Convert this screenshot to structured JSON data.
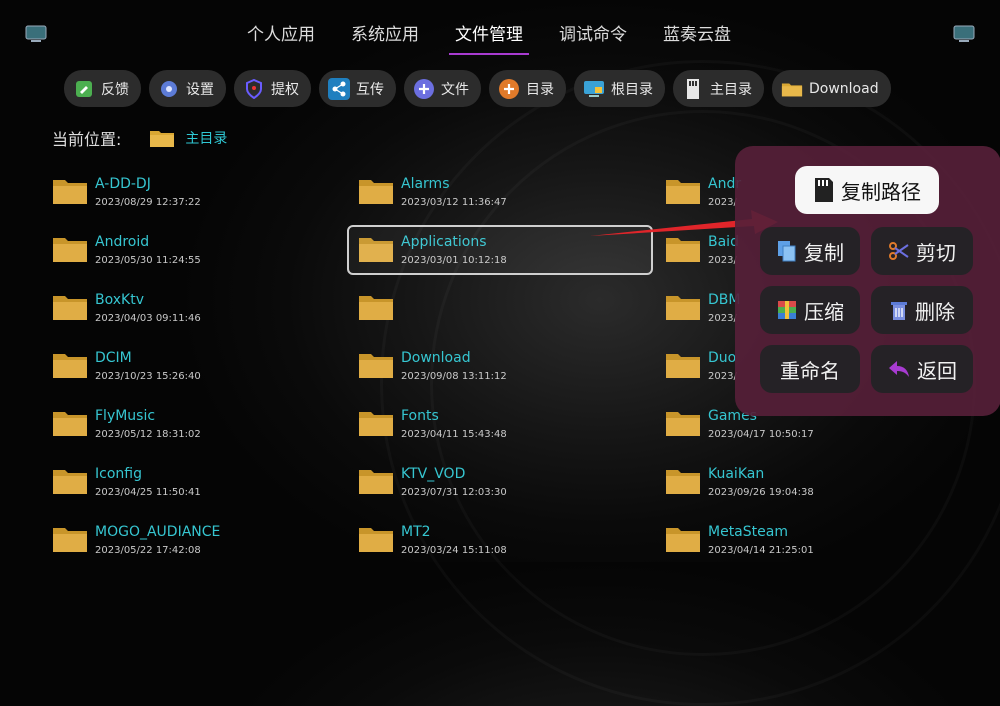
{
  "tabs": [
    {
      "label": "个人应用"
    },
    {
      "label": "系统应用"
    },
    {
      "label": "文件管理",
      "active": true
    },
    {
      "label": "调试命令"
    },
    {
      "label": "蓝奏云盘"
    }
  ],
  "toolbar": [
    {
      "label": "反馈",
      "icon": "feedback-icon"
    },
    {
      "label": "设置",
      "icon": "gear-icon"
    },
    {
      "label": "提权",
      "icon": "shield-icon"
    },
    {
      "label": "互传",
      "icon": "share-icon"
    },
    {
      "label": "文件",
      "icon": "add-file-icon"
    },
    {
      "label": "目录",
      "icon": "add-folder-icon"
    },
    {
      "label": "根目录",
      "icon": "root-dir-icon"
    },
    {
      "label": "主目录",
      "icon": "home-dir-icon"
    },
    {
      "label": "Download",
      "icon": "folder-icon"
    }
  ],
  "location": {
    "label": "当前位置:",
    "path": "主目录"
  },
  "files": [
    {
      "name": "A-DD-DJ",
      "date": "2023/08/29 12:37:22"
    },
    {
      "name": "Alarms",
      "date": "2023/03/12 11:36:47"
    },
    {
      "name": "Andr",
      "date": "2023/"
    },
    {
      "name": "Android",
      "date": "2023/05/30 11:24:55"
    },
    {
      "name": "Applications",
      "date": "2023/03/01 10:12:18"
    },
    {
      "name": "Baid",
      "date": "2023/"
    },
    {
      "name": "BoxKtv",
      "date": "2023/04/03 09:11:46"
    },
    {
      "name": "",
      "date": ""
    },
    {
      "name": "DBM",
      "date": "2023/"
    },
    {
      "name": "DCIM",
      "date": "2023/10/23 15:26:40"
    },
    {
      "name": "Download",
      "date": "2023/09/08 13:11:12"
    },
    {
      "name": "Duo",
      "date": "2023/"
    },
    {
      "name": "FlyMusic",
      "date": "2023/05/12 18:31:02"
    },
    {
      "name": "Fonts",
      "date": "2023/04/11 15:43:48"
    },
    {
      "name": "Games",
      "date": "2023/04/17 10:50:17"
    },
    {
      "name": "Iconfig",
      "date": "2023/04/25 11:50:41"
    },
    {
      "name": "KTV_VOD",
      "date": "2023/07/31 12:03:30"
    },
    {
      "name": "KuaiKan",
      "date": "2023/09/26 19:04:38"
    },
    {
      "name": "MOGO_AUDIANCE",
      "date": "2023/05/22 17:42:08"
    },
    {
      "name": "MT2",
      "date": "2023/03/24 15:11:08"
    },
    {
      "name": "MetaSteam",
      "date": "2023/04/14 21:25:01"
    }
  ],
  "menu": [
    {
      "label": "复制路径",
      "icon": "sd-card-icon"
    },
    {
      "label": "复制",
      "icon": "copy-icon"
    },
    {
      "label": "剪切",
      "icon": "scissors-icon"
    },
    {
      "label": "压缩",
      "icon": "archive-icon"
    },
    {
      "label": "删除",
      "icon": "trash-icon"
    },
    {
      "label": "重命名",
      "icon": ""
    },
    {
      "label": "返回",
      "icon": "back-arrow-icon"
    }
  ],
  "colors": {
    "accent": "#a83bd1",
    "filename": "#36c6d1",
    "folder": "#d9a733",
    "menu_bg": "#562038",
    "arrow": "#e0252a"
  }
}
